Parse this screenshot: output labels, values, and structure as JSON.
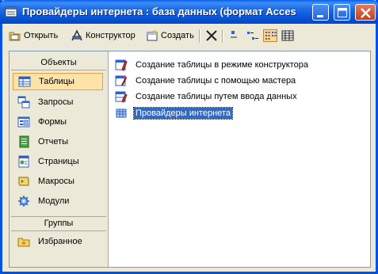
{
  "window": {
    "title": "Провайдеры интернета : база данных (формат Acces"
  },
  "toolbar": {
    "open_label": "Открыть",
    "design_label": "Конструктор",
    "create_label": "Создать",
    "active_view": "list"
  },
  "sidebar": {
    "objects_header": "Объекты",
    "groups_header": "Группы",
    "items": [
      {
        "label": "Таблицы",
        "icon": "table-icon",
        "selected": true
      },
      {
        "label": "Запросы",
        "icon": "query-icon"
      },
      {
        "label": "Формы",
        "icon": "form-icon"
      },
      {
        "label": "Отчеты",
        "icon": "report-icon"
      },
      {
        "label": "Страницы",
        "icon": "page-icon"
      },
      {
        "label": "Макросы",
        "icon": "macro-icon"
      },
      {
        "label": "Модули",
        "icon": "module-icon"
      }
    ],
    "group_items": [
      {
        "label": "Избранное",
        "icon": "favorites-icon"
      }
    ]
  },
  "objects_list": [
    {
      "label": "Создание таблицы в режиме конструктора",
      "icon": "create-design-icon"
    },
    {
      "label": "Создание таблицы с помощью мастера",
      "icon": "create-wizard-icon"
    },
    {
      "label": "Создание таблицы путем ввода данных",
      "icon": "create-entry-icon"
    },
    {
      "label": "Провайдеры интернета",
      "icon": "table-icon",
      "selected": true
    }
  ],
  "colors": {
    "title_bar": "#0b56d9",
    "selection": "#316ac5",
    "sidebar_selected": "#fde3a7"
  }
}
